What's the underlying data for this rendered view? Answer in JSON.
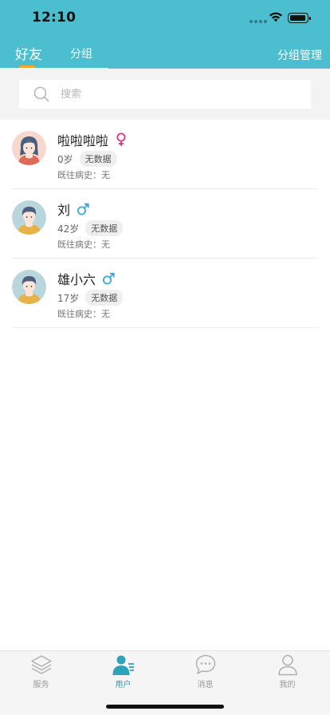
{
  "status_bar": {
    "time": "12:10"
  },
  "header": {
    "tabs": [
      {
        "label": "好友",
        "active": true
      },
      {
        "label": "分组",
        "active": false
      }
    ],
    "manage_label": "分组管理",
    "background_color": "#4bbecf",
    "indicator_color": "#f5a623"
  },
  "search": {
    "placeholder": "搜索",
    "value": ""
  },
  "friends": [
    {
      "name": "啦啦啦啦",
      "gender": "female",
      "gender_symbol": "♀",
      "age": "0岁",
      "tag": "无数据",
      "history": "既往病史：无",
      "avatar": "female-avatar-icon"
    },
    {
      "name": "刘",
      "gender": "male",
      "gender_symbol": "♂",
      "age": "42岁",
      "tag": "无数据",
      "history": "既往病史：无",
      "avatar": "male-avatar-icon"
    },
    {
      "name": "雄小六",
      "gender": "male",
      "gender_symbol": "♂",
      "age": "17岁",
      "tag": "无数据",
      "history": "既往病史：无",
      "avatar": "male-avatar-icon"
    }
  ],
  "tabbar": [
    {
      "label": "服务",
      "icon": "layers-icon",
      "active": false
    },
    {
      "label": "用户",
      "icon": "user-list-icon",
      "active": true
    },
    {
      "label": "消息",
      "icon": "chat-bubble-icon",
      "active": false
    },
    {
      "label": "我的",
      "icon": "person-icon",
      "active": false
    }
  ],
  "colors": {
    "accent": "#2ba3b8",
    "female": "#e0357b",
    "male": "#3aa7d8"
  }
}
